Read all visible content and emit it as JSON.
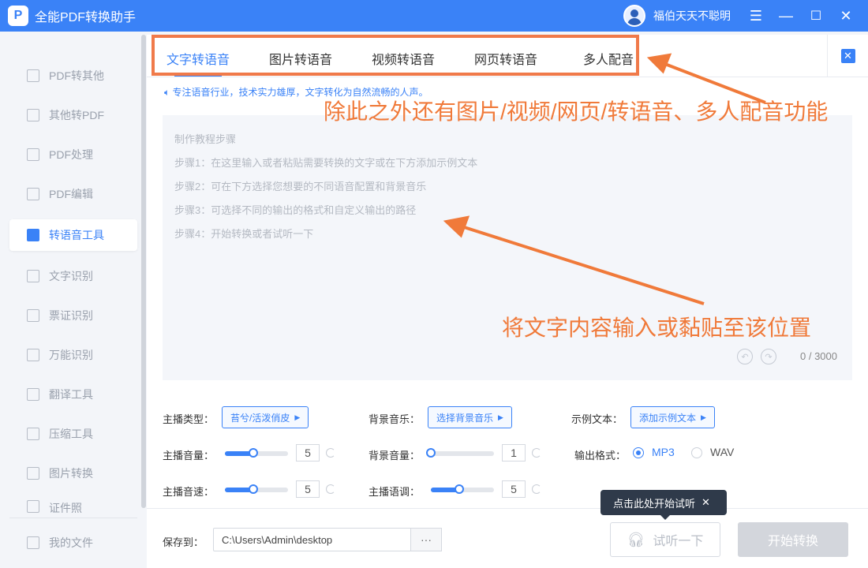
{
  "app": {
    "title": "全能PDF转换助手",
    "logo": "P",
    "username": "福伯天天不聪明"
  },
  "window_controls": {
    "menu": "☰",
    "minimize": "—",
    "maximize": "☐",
    "close": "✕"
  },
  "sidebar": {
    "items": [
      {
        "label": "PDF转其他",
        "icon": "pdf-export-icon"
      },
      {
        "label": "其他转PDF",
        "icon": "pdf-import-icon"
      },
      {
        "label": "PDF处理",
        "icon": "pdf-process-icon"
      },
      {
        "label": "PDF编辑",
        "icon": "pdf-edit-icon"
      },
      {
        "label": "转语音工具",
        "icon": "text-to-speech-icon",
        "active": true
      },
      {
        "label": "文字识别",
        "icon": "ocr-icon"
      },
      {
        "label": "票证识别",
        "icon": "ticket-icon"
      },
      {
        "label": "万能识别",
        "icon": "universal-recognize-icon"
      },
      {
        "label": "翻译工具",
        "icon": "translate-icon"
      },
      {
        "label": "压缩工具",
        "icon": "compress-icon"
      },
      {
        "label": "图片转换",
        "icon": "image-convert-icon"
      },
      {
        "label": "证件照",
        "icon": "id-photo-icon"
      }
    ],
    "my_files": "我的文件"
  },
  "tabs": [
    "文字转语音",
    "图片转语音",
    "视频转语音",
    "网页转语音",
    "多人配音"
  ],
  "tagline": "专注语音行业，技术实力雄厚，文字转化为自然流畅的人声。",
  "textarea": {
    "steps": [
      "制作教程步骤",
      "步骤1：在这里输入或者粘贴需要转换的文字或在下方添加示例文本",
      "步骤2：可在下方选择您想要的不同语音配置和背景音乐",
      "步骤3：可选择不同的输出的格式和自定义输出的路径",
      "步骤4：开始转换或者试听一下"
    ],
    "counter": "0 / 3000"
  },
  "annotations": {
    "top": "除此之外还有图片/视频/网页/转语音、多人配音功能",
    "middle": "将文字内容输入或黏贴至该位置"
  },
  "settings": {
    "anchor_type": {
      "label": "主播类型：",
      "value": "苔兮/活泼俏皮"
    },
    "bg_music": {
      "label": "背景音乐：",
      "value": "选择背景音乐"
    },
    "sample_text": {
      "label": "示例文本：",
      "value": "添加示例文本"
    },
    "anchor_volume": {
      "label": "主播音量：",
      "value": "5",
      "level": 0.45
    },
    "bg_volume": {
      "label": "背景音量：",
      "value": "1",
      "level": 0.0
    },
    "output_format": {
      "label": "输出格式：",
      "options": [
        "MP3",
        "WAV"
      ],
      "selected": "MP3"
    },
    "anchor_speed": {
      "label": "主播音速：",
      "value": "5",
      "level": 0.45
    },
    "anchor_pitch": {
      "label": "主播语调：",
      "value": "5",
      "level": 0.45
    }
  },
  "footer": {
    "save_label": "保存到：",
    "save_path": "C:\\Users\\Admin\\desktop",
    "more": "···",
    "trial": "试听一下",
    "start": "开始转换",
    "tooltip": "点击此处开始试听",
    "tooltip_close": "✕"
  },
  "colors": {
    "accent": "#3a82f7",
    "annotation": "#f07a3a"
  }
}
